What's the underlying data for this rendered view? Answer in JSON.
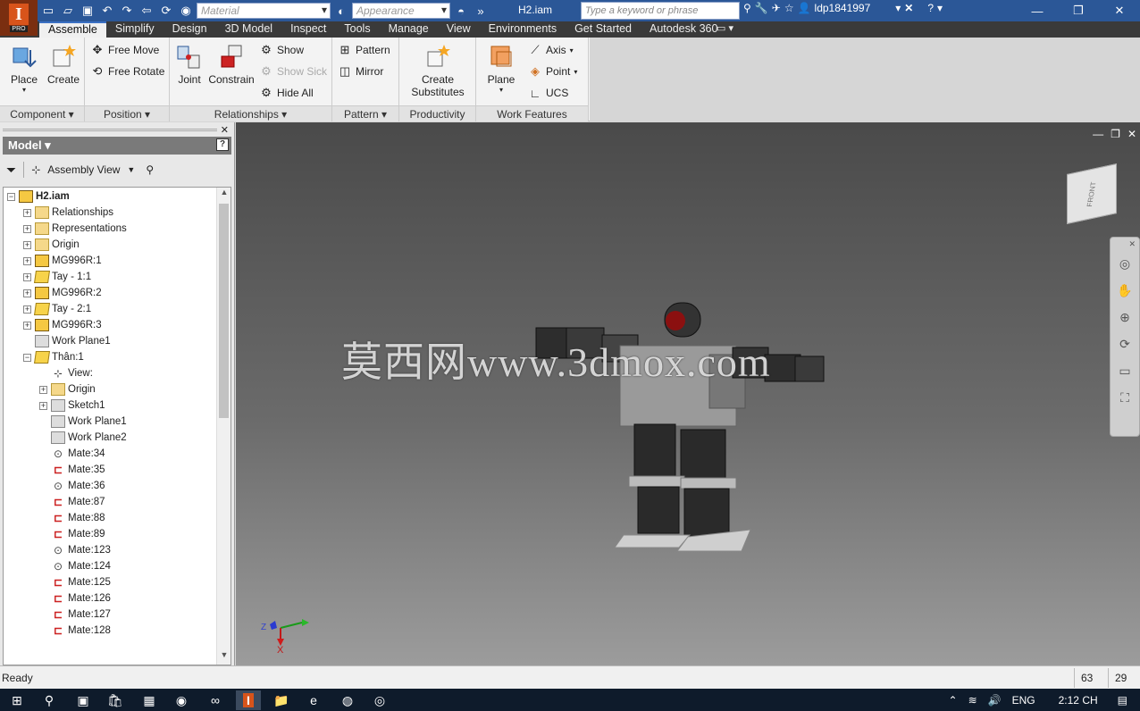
{
  "app": {
    "doc_name": "H2.iam",
    "pro_label": "PRO"
  },
  "titlebar": {
    "material_placeholder": "Material",
    "appearance_placeholder": "Appearance",
    "search_placeholder": "Type a keyword or phrase",
    "user": "ldp1841997"
  },
  "tabs": [
    "Assemble",
    "Simplify",
    "Design",
    "3D Model",
    "Inspect",
    "Tools",
    "Manage",
    "View",
    "Environments",
    "Get Started",
    "Autodesk 360"
  ],
  "ribbon": {
    "component": {
      "label": "Component",
      "place": "Place",
      "create": "Create"
    },
    "position": {
      "label": "Position",
      "free_move": "Free Move",
      "free_rotate": "Free Rotate"
    },
    "relationships": {
      "label": "Relationships",
      "joint": "Joint",
      "constrain": "Constrain",
      "show": "Show",
      "show_sick": "Show Sick",
      "hide_all": "Hide All"
    },
    "pattern": {
      "label": "Pattern",
      "pattern": "Pattern",
      "mirror": "Mirror"
    },
    "productivity": {
      "label": "Productivity",
      "create_substitutes_1": "Create",
      "create_substitutes_2": "Substitutes"
    },
    "work_features": {
      "label": "Work Features",
      "plane": "Plane",
      "axis": "Axis",
      "point": "Point",
      "ucs": "UCS"
    }
  },
  "model_panel": {
    "title": "Model",
    "view_mode": "Assembly View",
    "tree": [
      {
        "label": "H2.iam",
        "icon": "asm",
        "indent": 0,
        "exp": "minus",
        "bold": true
      },
      {
        "label": "Relationships",
        "icon": "folder",
        "indent": 1,
        "exp": "plus"
      },
      {
        "label": "Representations",
        "icon": "folder",
        "indent": 1,
        "exp": "plus"
      },
      {
        "label": "Origin",
        "icon": "folder",
        "indent": 1,
        "exp": "plus"
      },
      {
        "label": "MG996R:1",
        "icon": "asm",
        "indent": 1,
        "exp": "plus"
      },
      {
        "label": "Tay - 1:1",
        "icon": "part",
        "indent": 1,
        "exp": "plus"
      },
      {
        "label": "MG996R:2",
        "icon": "asm",
        "indent": 1,
        "exp": "plus"
      },
      {
        "label": "Tay - 2:1",
        "icon": "part",
        "indent": 1,
        "exp": "plus"
      },
      {
        "label": "MG996R:3",
        "icon": "asm",
        "indent": 1,
        "exp": "plus"
      },
      {
        "label": "Work Plane1",
        "icon": "plane",
        "indent": 1,
        "exp": "none"
      },
      {
        "label": "Thân:1",
        "icon": "part",
        "indent": 1,
        "exp": "minus"
      },
      {
        "label": "View:",
        "icon": "view",
        "indent": 2,
        "exp": "none"
      },
      {
        "label": "Origin",
        "icon": "folder",
        "indent": 2,
        "exp": "plus"
      },
      {
        "label": "Sketch1",
        "icon": "plane",
        "indent": 2,
        "exp": "plus"
      },
      {
        "label": "Work Plane1",
        "icon": "plane",
        "indent": 2,
        "exp": "none"
      },
      {
        "label": "Work Plane2",
        "icon": "plane",
        "indent": 2,
        "exp": "none"
      },
      {
        "label": "Mate:34",
        "icon": "mate2",
        "indent": 2,
        "exp": "none"
      },
      {
        "label": "Mate:35",
        "icon": "mate1",
        "indent": 2,
        "exp": "none"
      },
      {
        "label": "Mate:36",
        "icon": "mate2",
        "indent": 2,
        "exp": "none"
      },
      {
        "label": "Mate:87",
        "icon": "mate1",
        "indent": 2,
        "exp": "none"
      },
      {
        "label": "Mate:88",
        "icon": "mate1",
        "indent": 2,
        "exp": "none"
      },
      {
        "label": "Mate:89",
        "icon": "mate1",
        "indent": 2,
        "exp": "none"
      },
      {
        "label": "Mate:123",
        "icon": "mate2",
        "indent": 2,
        "exp": "none"
      },
      {
        "label": "Mate:124",
        "icon": "mate2",
        "indent": 2,
        "exp": "none"
      },
      {
        "label": "Mate:125",
        "icon": "mate1",
        "indent": 2,
        "exp": "none"
      },
      {
        "label": "Mate:126",
        "icon": "mate1",
        "indent": 2,
        "exp": "none"
      },
      {
        "label": "Mate:127",
        "icon": "mate1",
        "indent": 2,
        "exp": "none"
      },
      {
        "label": "Mate:128",
        "icon": "mate1",
        "indent": 2,
        "exp": "none"
      }
    ]
  },
  "viewport": {
    "watermark": "莫西网www.3dmox.com",
    "viewcube_face": "FRONT",
    "triad_x": "X",
    "triad_z": "Z"
  },
  "status": {
    "text": "Ready",
    "num1": "63",
    "num2": "29"
  },
  "taskbar": {
    "lang": "ENG",
    "time": "2:12 CH"
  },
  "colors": {
    "accent": "#2b5797",
    "tab_bar": "#3a3a3a",
    "taskbar": "#0e1b2b"
  }
}
